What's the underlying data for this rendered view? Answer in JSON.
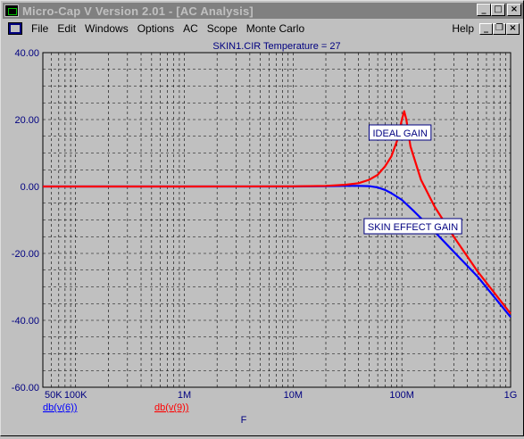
{
  "window": {
    "title": "Micro-Cap V Version 2.01 - [AC Analysis]",
    "buttons": {
      "minimize": "_",
      "maximize": "□",
      "close": "×"
    },
    "doc_buttons": {
      "minimize": "_",
      "restore": "❐",
      "close": "×"
    }
  },
  "menu": {
    "items": [
      "File",
      "Edit",
      "Windows",
      "Options",
      "AC",
      "Scope",
      "Monte Carlo"
    ],
    "help": "Help"
  },
  "chart_data": {
    "type": "line",
    "title": "SKIN1.CIR Temperature = 27",
    "xlabel": "F",
    "x_scale": "log",
    "xlim": [
      50000,
      1000000000
    ],
    "ylim": [
      -60,
      40
    ],
    "grid": true,
    "y_ticks": [
      "40.00",
      "20.00",
      "0.00",
      "-20.00",
      "-40.00",
      "-60.00"
    ],
    "x_ticks": [
      {
        "value": 50000,
        "label": "50K"
      },
      {
        "value": 100000,
        "label": "100K"
      },
      {
        "value": 1000000,
        "label": "1M"
      },
      {
        "value": 10000000,
        "label": "10M"
      },
      {
        "value": 100000000,
        "label": "100M"
      },
      {
        "value": 1000000000,
        "label": "1G"
      }
    ],
    "series": [
      {
        "name": "db(v(6))",
        "color": "#0000ff",
        "x": [
          50000,
          1000000,
          10000000,
          20000000,
          30000000,
          40000000,
          50000000,
          60000000,
          70000000,
          80000000,
          100000000,
          130000000,
          200000000,
          300000000,
          500000000,
          1000000000
        ],
        "y": [
          0,
          0,
          0,
          0.1,
          0.2,
          0.2,
          0.1,
          -0.3,
          -1.0,
          -2.0,
          -4.0,
          -7.5,
          -13.5,
          -19.5,
          -27,
          -39
        ]
      },
      {
        "name": "db(v(9))",
        "color": "#ff0000",
        "x": [
          50000,
          1000000,
          10000000,
          20000000,
          30000000,
          40000000,
          50000000,
          60000000,
          70000000,
          80000000,
          90000000,
          100000000,
          105000000,
          110000000,
          120000000,
          150000000,
          200000000,
          300000000,
          500000000,
          1000000000
        ],
        "y": [
          0,
          0,
          0.05,
          0.2,
          0.5,
          1.0,
          2.0,
          3.5,
          6.0,
          9.0,
          13.5,
          20.0,
          22.5,
          20.0,
          12.0,
          2.0,
          -6.0,
          -15.0,
          -25.5,
          -38.0
        ]
      }
    ],
    "annotations": [
      {
        "text": "IDEAL GAIN",
        "x": 50000000,
        "y": 16
      },
      {
        "text": "SKIN EFFECT GAIN",
        "x": 45000000,
        "y": -12
      }
    ]
  }
}
